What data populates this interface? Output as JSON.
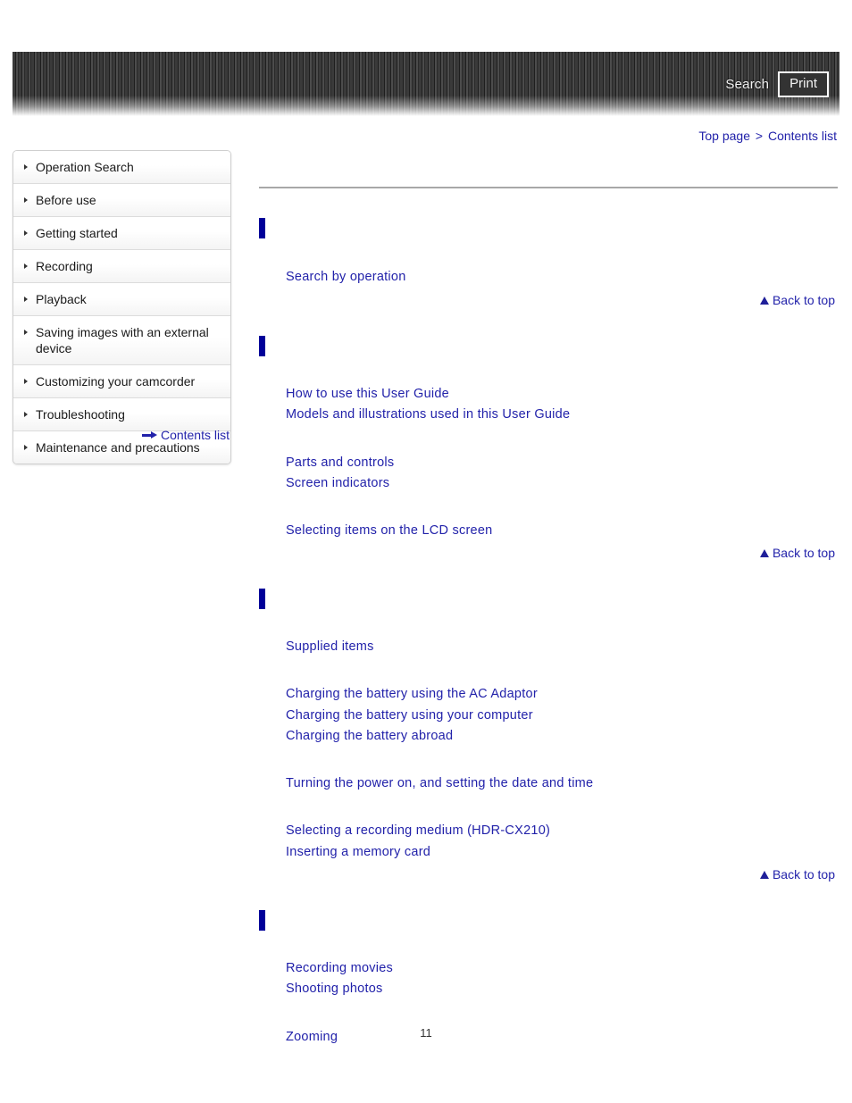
{
  "header": {
    "search_label": "Search",
    "print_label": "Print",
    "search_icon": "search-icon",
    "print_icon": "print-icon"
  },
  "breadcrumb": {
    "top_page": "Top page",
    "separator": ">",
    "contents_list": "Contents list"
  },
  "sidebar": {
    "items": [
      {
        "label": "Operation Search"
      },
      {
        "label": "Before use"
      },
      {
        "label": "Getting started"
      },
      {
        "label": "Recording"
      },
      {
        "label": "Playback"
      },
      {
        "label": "Saving images with an external device"
      },
      {
        "label": "Customizing your camcorder"
      },
      {
        "label": "Troubleshooting"
      },
      {
        "label": "Maintenance and precautions"
      }
    ],
    "contents_list_link": "Contents list",
    "contents_list_icon": "arrow-right-icon"
  },
  "main": {
    "back_to_top_label": "Back to top",
    "back_to_top_icon": "triangle-up-icon",
    "sections": [
      {
        "title": "",
        "groups": [
          {
            "links": [
              "Search by operation"
            ]
          }
        ]
      },
      {
        "title": "",
        "groups": [
          {
            "links": [
              "How to use this User Guide",
              "Models and illustrations used in this User Guide"
            ]
          },
          {
            "links": [
              "Parts and controls",
              "Screen indicators"
            ]
          },
          {
            "links": [
              "Selecting items on the LCD screen"
            ]
          }
        ]
      },
      {
        "title": "",
        "groups": [
          {
            "links": [
              "Supplied items"
            ]
          },
          {
            "links": [
              "Charging the battery using the AC Adaptor",
              "Charging the battery using your computer",
              "Charging the battery abroad"
            ]
          },
          {
            "links": [
              "Turning the power on, and setting the date and time"
            ]
          },
          {
            "links": [
              "Selecting a recording medium (HDR-CX210)",
              "Inserting a memory card"
            ]
          }
        ]
      },
      {
        "title": "",
        "groups": [
          {
            "links": [
              "Recording movies",
              "Shooting photos"
            ]
          },
          {
            "links": [
              "Zooming"
            ]
          }
        ]
      }
    ]
  },
  "footer": {
    "page_number": "11"
  },
  "colors": {
    "link": "#2222aa",
    "marker": "#000099",
    "rule": "#a8a8a8",
    "header_dark": "#3a3a3a"
  }
}
